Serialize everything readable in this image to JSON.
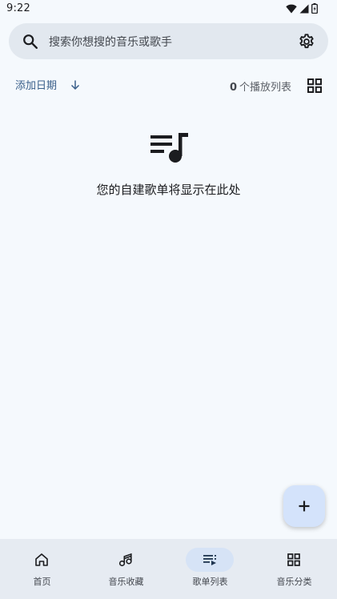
{
  "status_bar": {
    "time": "9:22",
    "icons": [
      "wifi-icon",
      "signal-icon",
      "battery-icon"
    ]
  },
  "search": {
    "placeholder": "搜索你想搜的音乐或歌手",
    "icon": "search-icon",
    "settings_icon": "gear-icon"
  },
  "toolbar": {
    "sort_label": "添加日期",
    "sort_icon": "arrow-down-icon",
    "count": "0",
    "count_suffix": "个播放列表",
    "view_icon": "grid-view-icon"
  },
  "empty_state": {
    "icon": "playlist-music-icon",
    "message": "您的自建歌单将显示在此处"
  },
  "fab": {
    "icon": "plus-icon"
  },
  "bottom_nav": {
    "items": [
      {
        "label": "首页",
        "icon": "home-icon",
        "active": false
      },
      {
        "label": "音乐收藏",
        "icon": "music-note-icon",
        "active": false
      },
      {
        "label": "歌单列表",
        "icon": "playlist-icon",
        "active": true
      },
      {
        "label": "音乐分类",
        "icon": "category-grid-icon",
        "active": false
      }
    ]
  },
  "colors": {
    "background": "#f5f9fd",
    "search_bg": "#e2e8ef",
    "accent": "#3a5f8a",
    "fab_bg": "#d4e3fb",
    "nav_bg": "#e6ebf2",
    "nav_active_pill": "#d6e3f6"
  }
}
